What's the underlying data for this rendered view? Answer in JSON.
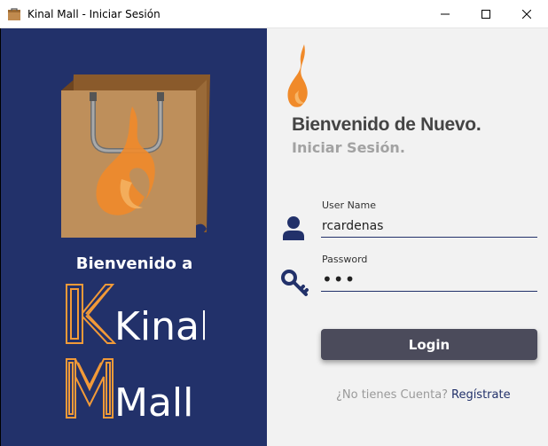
{
  "window": {
    "title": "Kinal Mall - Iniciar Sesión",
    "app_icon": "shopping-bag-icon",
    "controls": [
      "minimize-icon",
      "maximize-icon",
      "close-icon"
    ]
  },
  "left_panel": {
    "illustration": "shopping-bag-flame-icon",
    "welcome_text": "Bienvenido a",
    "logo": [
      "Kinal",
      "Mall"
    ],
    "background": "#22316a"
  },
  "right_panel": {
    "logo_icon": "flame-icon",
    "heading": "Bienvenido de Nuevo.",
    "subheading": "Iniciar Sesión.",
    "username": {
      "label": "User Name",
      "value": "rcardenas",
      "icon": "user-icon"
    },
    "password": {
      "label": "Password",
      "value": "•••",
      "icon": "key-icon"
    },
    "login_button": "Login",
    "no_account_text": "¿No tienes Cuenta?",
    "register_link": "Regístrate"
  },
  "colors": {
    "navy": "#22316a",
    "orange": "#f08a2a",
    "button": "#4b4b5b"
  }
}
